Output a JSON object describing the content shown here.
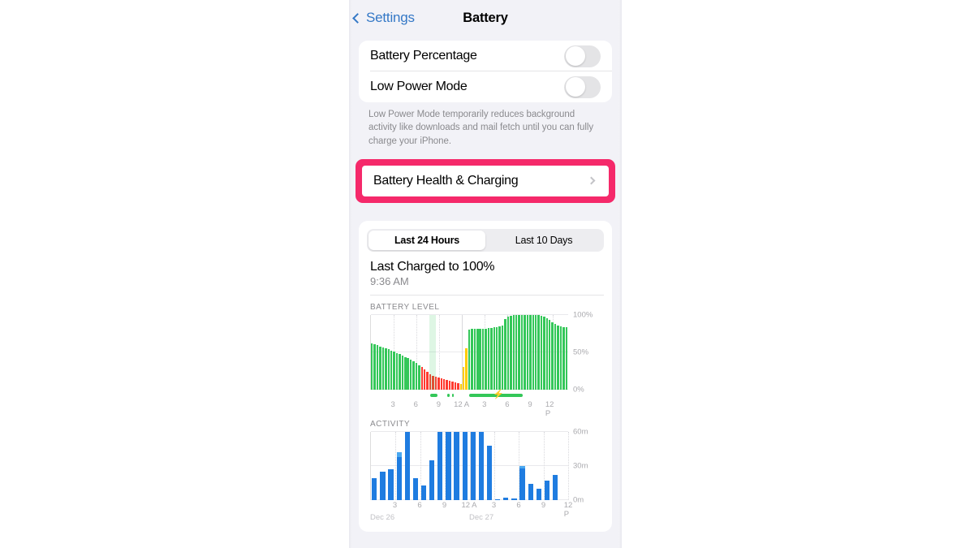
{
  "nav": {
    "back_label": "Settings",
    "back_icon": "chevron-left-icon",
    "title": "Battery"
  },
  "settings_group": {
    "rows": [
      {
        "label": "Battery Percentage",
        "control": "toggle",
        "state": "off"
      },
      {
        "label": "Low Power Mode",
        "control": "toggle",
        "state": "off"
      }
    ],
    "footnote": "Low Power Mode temporarily reduces background activity like downloads and mail fetch until you can fully charge your iPhone."
  },
  "health_row": {
    "label": "Battery Health & Charging",
    "disclosure_icon": "chevron-right-icon",
    "highlight_color": "#f5296a"
  },
  "usage": {
    "segments": [
      {
        "label": "Last 24 Hours",
        "selected": true
      },
      {
        "label": "Last 10 Days",
        "selected": false
      }
    ],
    "last_charged_title": "Last Charged to 100%",
    "last_charged_time": "9:36 AM"
  },
  "colors": {
    "green": "#34c759",
    "red": "#ff3b30",
    "yellow": "#ffcc00",
    "blue": "#1f7ce0",
    "blue_light": "#4aa8f0",
    "accent_pink": "#f5296a",
    "ios_blue": "#3478c6"
  },
  "chart_data": [
    {
      "type": "bar",
      "name": "battery-level-chart",
      "title": "BATTERY LEVEL",
      "xlabel": "",
      "ylabel": "",
      "ylim": [
        0,
        100
      ],
      "yticks": [
        0,
        50,
        100
      ],
      "ytick_labels": [
        "0%",
        "50%",
        "100%"
      ],
      "grid": true,
      "xtick_labels": [
        "3",
        "6",
        "9",
        "12 A",
        "3",
        "6",
        "9",
        "12 P"
      ],
      "xtick_positions": [
        6,
        12,
        18,
        24,
        30,
        36,
        42,
        48
      ],
      "categories_count": 52,
      "values": [
        62,
        61,
        60,
        58,
        57,
        55,
        54,
        52,
        51,
        49,
        48,
        46,
        44,
        42,
        40,
        38,
        36,
        33,
        30,
        27,
        24,
        21,
        19,
        17,
        16,
        15,
        14,
        13,
        12,
        11,
        10,
        9,
        8,
        30,
        55,
        80,
        81,
        81,
        82,
        82,
        82,
        82,
        83,
        83,
        84,
        84,
        85,
        86,
        95,
        98,
        99,
        100,
        100,
        100,
        100,
        100,
        100,
        100,
        100,
        100,
        100,
        99,
        98,
        96,
        93,
        90,
        88,
        86,
        85,
        84,
        84
      ],
      "bar_colors": [
        "green",
        "green",
        "green",
        "green",
        "green",
        "green",
        "green",
        "green",
        "green",
        "green",
        "green",
        "green",
        "green",
        "green",
        "green",
        "green",
        "green",
        "green",
        "red",
        "red",
        "red",
        "red",
        "red",
        "red",
        "red",
        "red",
        "red",
        "red",
        "red",
        "red",
        "red",
        "red",
        "yellow",
        "yellow",
        "yellow",
        "green",
        "green",
        "green",
        "green",
        "green",
        "green",
        "green",
        "green",
        "green",
        "green",
        "green",
        "green",
        "green",
        "green",
        "green",
        "green",
        "green",
        "green",
        "green",
        "green",
        "green",
        "green",
        "green",
        "green",
        "green",
        "green",
        "green",
        "green",
        "green",
        "green",
        "green",
        "green",
        "green",
        "green",
        "green",
        "green"
      ],
      "charge_segments": [
        {
          "start_pct": 30.5,
          "end_pct": 34.0,
          "bolt": false
        },
        {
          "start_pct": 39.0,
          "end_pct": 40.0,
          "bolt": false
        },
        {
          "start_pct": 41.2,
          "end_pct": 42.2,
          "bolt": false
        },
        {
          "start_pct": 50.0,
          "end_pct": 77.0,
          "bolt": true
        }
      ],
      "highlight_band": {
        "start_pct": 29.5,
        "end_pct": 33.0
      }
    },
    {
      "type": "bar",
      "name": "activity-chart",
      "title": "ACTIVITY",
      "xlabel": "",
      "ylabel": "",
      "ylim": [
        0,
        60
      ],
      "yticks": [
        0,
        30,
        60
      ],
      "ytick_labels": [
        "0m",
        "30m",
        "60m"
      ],
      "grid": true,
      "xtick_labels": [
        "3",
        "6",
        "9",
        "12 A",
        "3",
        "6",
        "9",
        "12 P"
      ],
      "xtick_positions": [
        3,
        6,
        9,
        12,
        15,
        18,
        21,
        24
      ],
      "date_labels": [
        {
          "text": "Dec 26",
          "position": 0
        },
        {
          "text": "Dec 27",
          "position": 12
        }
      ],
      "categories": [
        "2",
        "3",
        "4",
        "5",
        "6",
        "7",
        "8",
        "9",
        "10",
        "11",
        "12",
        "13",
        "14",
        "15",
        "16",
        "17",
        "18",
        "19",
        "20",
        "21",
        "22",
        "23",
        "24",
        "25"
      ],
      "values": [
        19,
        25,
        27,
        38,
        60,
        19,
        13,
        35,
        60,
        60,
        60,
        60,
        60,
        60,
        48,
        1,
        2,
        1.5,
        28,
        14,
        10,
        17,
        22,
        0
      ],
      "highlight_values": [
        0,
        0,
        0,
        42,
        0,
        0,
        0,
        0,
        0,
        0,
        0,
        0,
        0,
        0,
        0,
        0,
        0,
        0,
        30,
        0,
        0,
        0,
        0,
        0
      ]
    }
  ]
}
